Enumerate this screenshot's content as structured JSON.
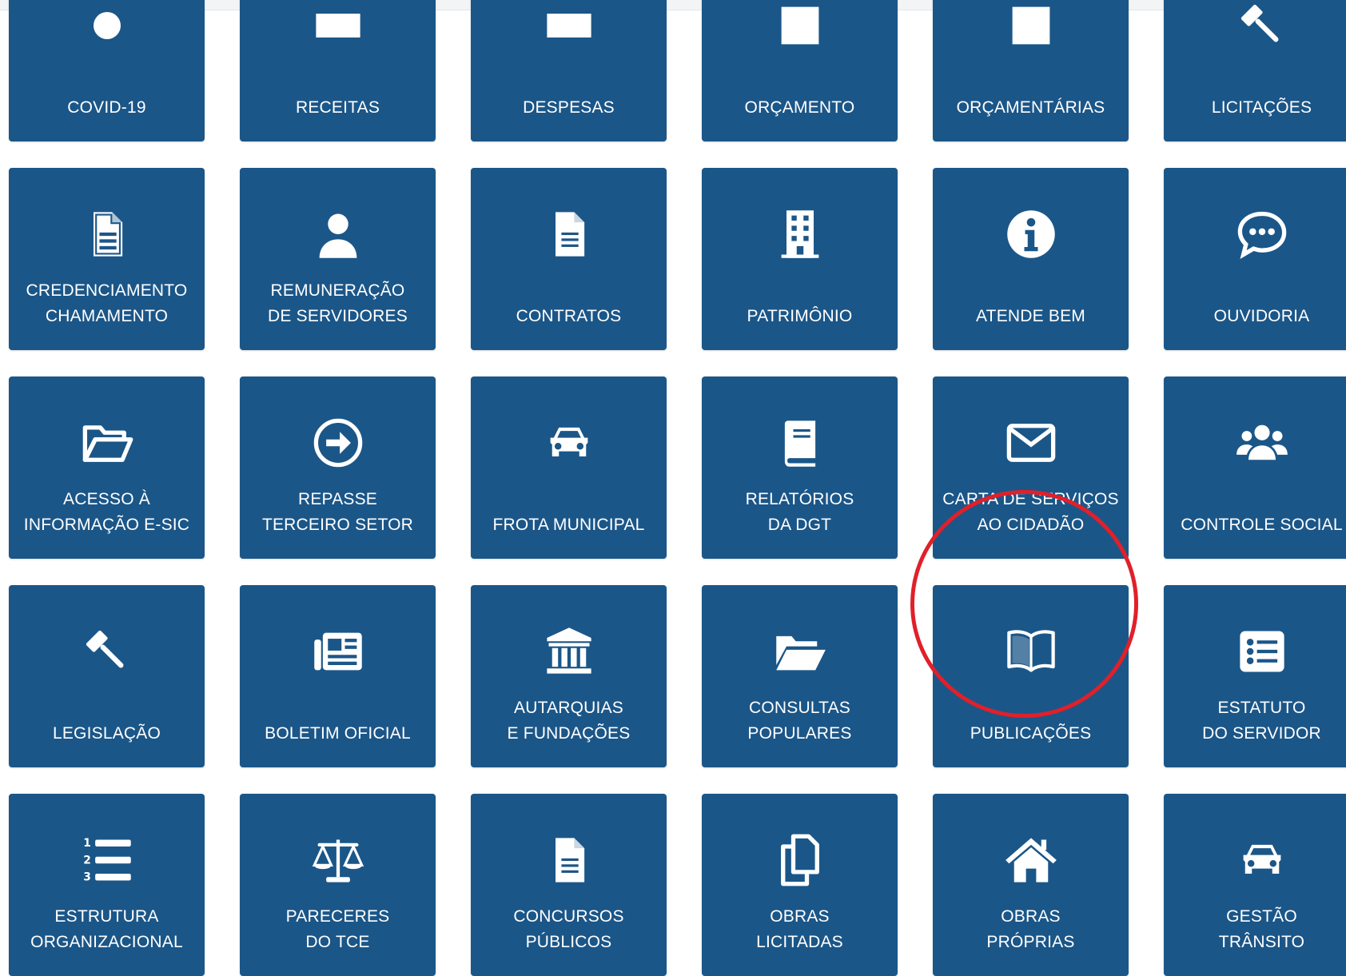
{
  "tiles": [
    {
      "lines": [
        "COVID-19",
        ""
      ],
      "icon": "virus-icon"
    },
    {
      "lines": [
        "RECEITAS",
        ""
      ],
      "icon": "money-in-icon"
    },
    {
      "lines": [
        "DESPESAS",
        ""
      ],
      "icon": "money-out-icon"
    },
    {
      "lines": [
        "ORÇAMENTO",
        ""
      ],
      "icon": "budget-icon"
    },
    {
      "lines": [
        "ORÇAMENTÁRIAS",
        ""
      ],
      "icon": "budget-laws-icon"
    },
    {
      "lines": [
        "LICITAÇÕES",
        ""
      ],
      "icon": "gavel-icon"
    },
    {
      "lines": [
        "CREDENCIAMENTO",
        "CHAMAMENTO"
      ],
      "icon": "document-icon"
    },
    {
      "lines": [
        "REMUNERAÇÃO",
        "DE SERVIDORES"
      ],
      "icon": "user-icon"
    },
    {
      "lines": [
        "",
        "CONTRATOS"
      ],
      "icon": "file-text-icon"
    },
    {
      "lines": [
        "",
        "PATRIMÔNIO"
      ],
      "icon": "building-icon"
    },
    {
      "lines": [
        "",
        "ATENDE BEM"
      ],
      "icon": "info-icon"
    },
    {
      "lines": [
        "",
        "OUVIDORIA"
      ],
      "icon": "chat-bubble-icon"
    },
    {
      "lines": [
        "ACESSO À",
        "INFORMAÇÃO E-SIC"
      ],
      "icon": "folder-open-icon"
    },
    {
      "lines": [
        "REPASSE",
        "TERCEIRO SETOR"
      ],
      "icon": "arrow-circle-right-icon"
    },
    {
      "lines": [
        "",
        "FROTA MUNICIPAL"
      ],
      "icon": "car-icon"
    },
    {
      "lines": [
        "RELATÓRIOS",
        "DA DGT"
      ],
      "icon": "book-icon"
    },
    {
      "lines": [
        "CARTA DE SERVIÇOS",
        "AO CIDADÃO"
      ],
      "icon": "envelope-icon"
    },
    {
      "lines": [
        "",
        "CONTROLE SOCIAL"
      ],
      "icon": "users-icon"
    },
    {
      "lines": [
        "",
        "LEGISLAÇÃO"
      ],
      "icon": "gavel-icon"
    },
    {
      "lines": [
        "",
        "BOLETIM OFICIAL"
      ],
      "icon": "newspaper-icon"
    },
    {
      "lines": [
        "AUTARQUIAS",
        "E FUNDAÇÕES"
      ],
      "icon": "institution-icon"
    },
    {
      "lines": [
        "CONSULTAS",
        "POPULARES"
      ],
      "icon": "folder-open-solid-icon"
    },
    {
      "lines": [
        "",
        "PUBLICAÇÕES"
      ],
      "icon": "open-book-icon"
    },
    {
      "lines": [
        "ESTATUTO",
        "DO SERVIDOR"
      ],
      "icon": "list-alt-icon"
    },
    {
      "lines": [
        "ESTRUTURA",
        "ORGANIZACIONAL"
      ],
      "icon": "list-ol-icon"
    },
    {
      "lines": [
        "PARECERES",
        "DO TCE"
      ],
      "icon": "balance-scale-icon"
    },
    {
      "lines": [
        "CONCURSOS",
        "PÚBLICOS"
      ],
      "icon": "file-text-icon"
    },
    {
      "lines": [
        "OBRAS",
        "LICITADAS"
      ],
      "icon": "copy-icon"
    },
    {
      "lines": [
        "OBRAS",
        "PRÓPRIAS"
      ],
      "icon": "home-icon"
    },
    {
      "lines": [
        "GESTÃO",
        "TRÂNSITO"
      ],
      "icon": "car-icon"
    }
  ],
  "colors": {
    "tile_bg": "#1b5688",
    "highlight": "#e0202a"
  }
}
